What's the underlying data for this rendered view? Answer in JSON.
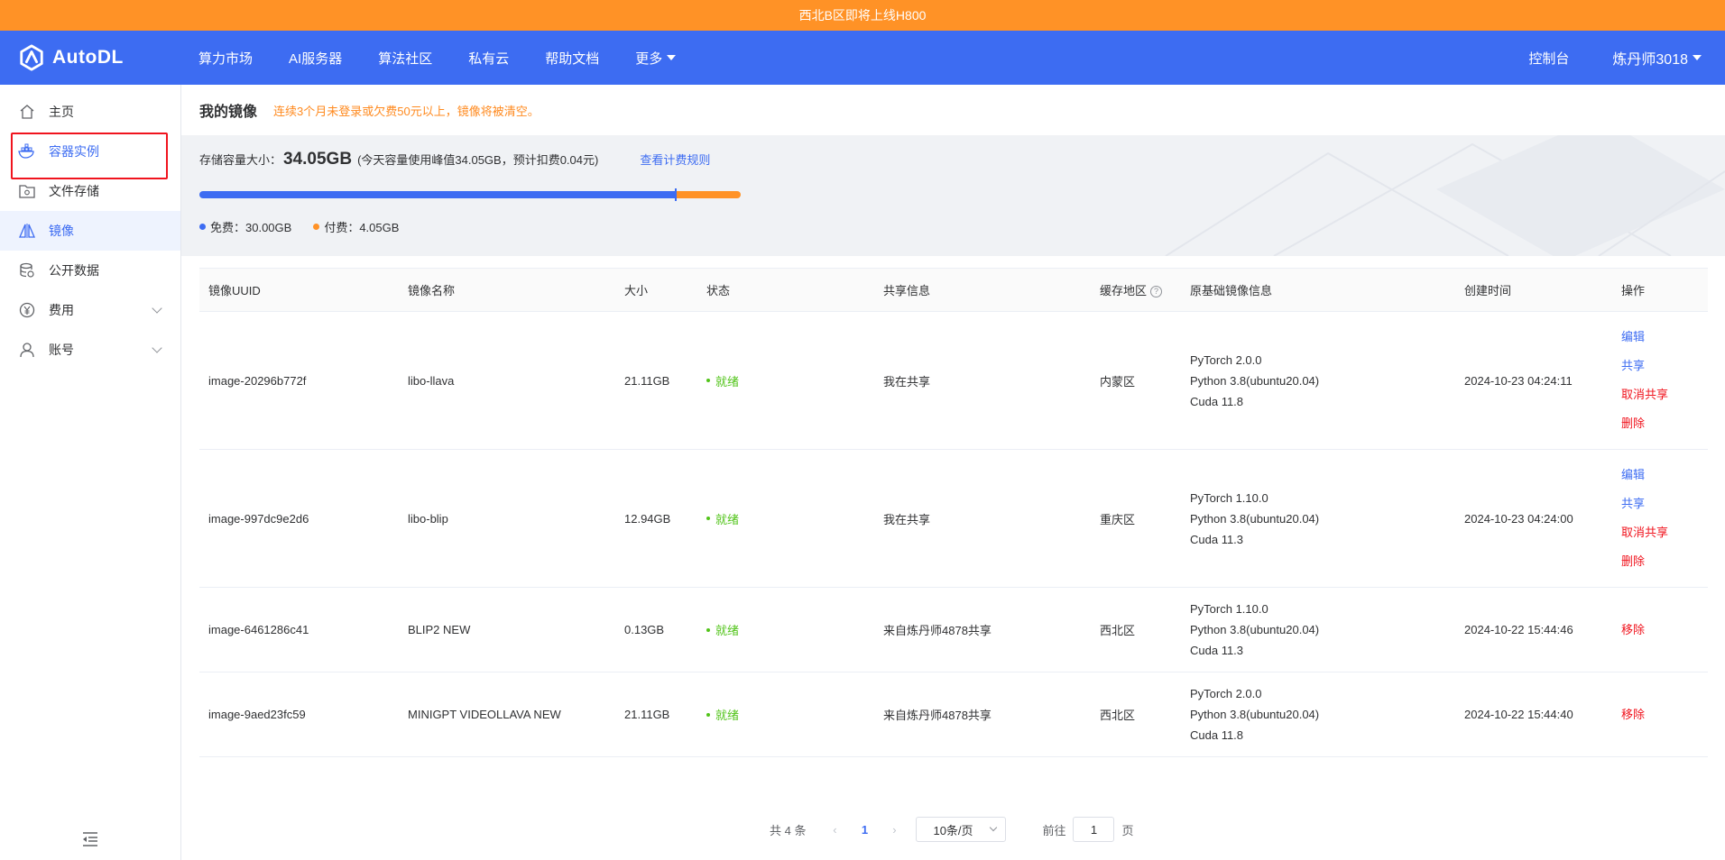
{
  "announcement": "西北B区即将上线H800",
  "brand": {
    "name": "AutoDL"
  },
  "nav": {
    "items": [
      "算力市场",
      "AI服务器",
      "算法社区",
      "私有云",
      "帮助文档",
      "更多"
    ],
    "console": "控制台",
    "user": "炼丹师3018"
  },
  "sidebar": {
    "items": [
      {
        "label": "主页",
        "icon": "home-icon"
      },
      {
        "label": "容器实例",
        "icon": "docker-icon"
      },
      {
        "label": "文件存储",
        "icon": "folder-icon"
      },
      {
        "label": "镜像",
        "icon": "mirror-icon"
      },
      {
        "label": "公开数据",
        "icon": "database-icon"
      },
      {
        "label": "费用",
        "icon": "yuan-icon"
      },
      {
        "label": "账号",
        "icon": "user-icon"
      }
    ],
    "active": "镜像",
    "highlighted": "容器实例"
  },
  "page": {
    "title": "我的镜像",
    "warning": "连续3个月未登录或欠费50元以上，镜像将被清空。"
  },
  "storage": {
    "label": "存储容量大小：",
    "size": "34.05GB",
    "detail": "(今天容量使用峰值34.05GB，预计扣费0.04元)",
    "link": "查看计费规则",
    "free_label": "免费：30.00GB",
    "paid_label": "付费：4.05GB",
    "free_gb": 30.0,
    "paid_gb": 4.05,
    "free_color": "#3d6cf2",
    "paid_color": "#ff9226"
  },
  "table": {
    "headers": [
      "镜像UUID",
      "镜像名称",
      "大小",
      "状态",
      "共享信息",
      "缓存地区",
      "原基础镜像信息",
      "创建时间",
      "操作"
    ],
    "rows": [
      {
        "uuid": "image-20296b772f",
        "name": "libo-llava",
        "size": "21.11GB",
        "status": "就绪",
        "share": "我在共享",
        "region": "内蒙区",
        "base": [
          "PyTorch  2.0.0",
          "Python  3.8(ubuntu20.04)",
          "Cuda  11.8"
        ],
        "created": "2024-10-23 04:24:11",
        "ops": [
          "编辑",
          "共享",
          "取消共享",
          "删除"
        ]
      },
      {
        "uuid": "image-997dc9e2d6",
        "name": "libo-blip",
        "size": "12.94GB",
        "status": "就绪",
        "share": "我在共享",
        "region": "重庆区",
        "base": [
          "PyTorch  1.10.0",
          "Python  3.8(ubuntu20.04)",
          "Cuda  11.3"
        ],
        "created": "2024-10-23 04:24:00",
        "ops": [
          "编辑",
          "共享",
          "取消共享",
          "删除"
        ]
      },
      {
        "uuid": "image-6461286c41",
        "name": "BLIP2 NEW",
        "size": "0.13GB",
        "status": "就绪",
        "share": "来自炼丹师4878共享",
        "region": "西北区",
        "base": [
          "PyTorch  1.10.0",
          "Python  3.8(ubuntu20.04)",
          "Cuda  11.3"
        ],
        "created": "2024-10-22 15:44:46",
        "ops": [
          "移除"
        ]
      },
      {
        "uuid": "image-9aed23fc59",
        "name": "MINIGPT VIDEOLLAVA NEW",
        "size": "21.11GB",
        "status": "就绪",
        "share": "来自炼丹师4878共享",
        "region": "西北区",
        "base": [
          "PyTorch  2.0.0",
          "Python  3.8(ubuntu20.04)",
          "Cuda  11.8"
        ],
        "created": "2024-10-22 15:44:40",
        "ops": [
          "移除"
        ]
      }
    ]
  },
  "pagination": {
    "total": "共 4 条",
    "current": "1",
    "page_size": "10条/页",
    "goto_label": "前往",
    "goto_value": "1",
    "page_suffix": "页"
  }
}
